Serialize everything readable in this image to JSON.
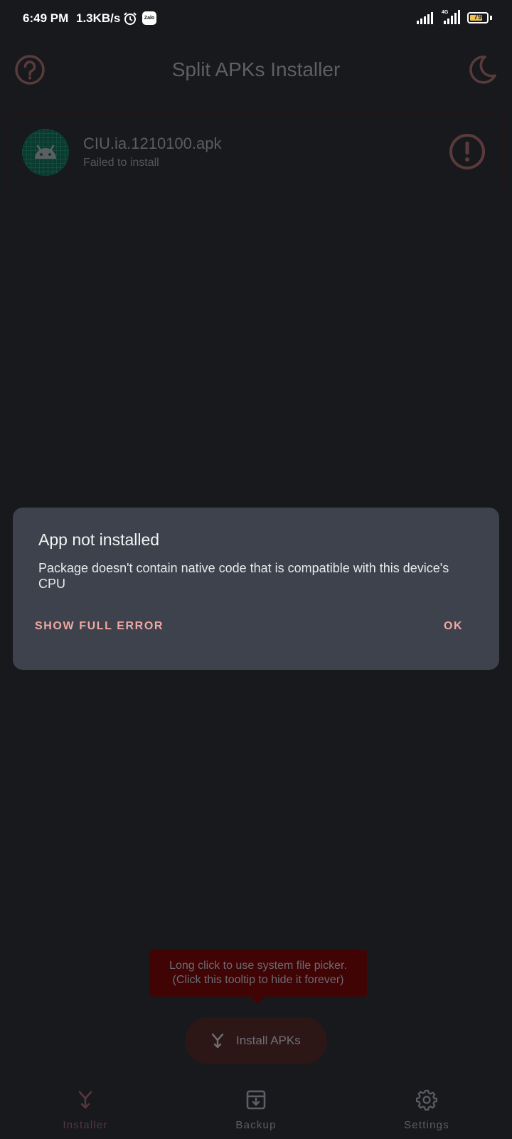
{
  "status_bar": {
    "time": "6:49 PM",
    "net_speed": "1.3KB/s",
    "zalo_label": "Zalo",
    "network_type": "4G",
    "battery_level": "79",
    "battery_fraction": 0.79,
    "icons": [
      "alarm-icon",
      "zalo-icon",
      "signal-icon",
      "signal-4g-icon",
      "battery-icon"
    ]
  },
  "app_bar": {
    "title": "Split APKs Installer",
    "icons": [
      "help-icon",
      "moon-icon"
    ]
  },
  "installation": {
    "file_name": "CIU.ia.1210100.apk",
    "status": "Failed to install",
    "icons": [
      "android-icon",
      "warning-icon"
    ]
  },
  "dialog": {
    "title": "App not installed",
    "message": "Package doesn't contain native code that is compatible with this device's CPU",
    "show_full_error_label": "SHOW FULL ERROR",
    "ok_label": "OK"
  },
  "tooltip": {
    "line1": "Long click to use system file picker.",
    "line2": "(Click this tooltip to hide it forever)"
  },
  "fab": {
    "label": "Install APKs",
    "icon": "merge-icon"
  },
  "bottom_nav": {
    "items": [
      {
        "label": "Installer",
        "icon": "merge-icon",
        "active": true
      },
      {
        "label": "Backup",
        "icon": "archive-icon",
        "active": false
      },
      {
        "label": "Settings",
        "icon": "gear-icon",
        "active": false
      }
    ]
  },
  "colors": {
    "background": "#18191d",
    "dialog_background": "#3d424d",
    "accent": "#f1a7a2",
    "tooltip_background": "#400405"
  }
}
